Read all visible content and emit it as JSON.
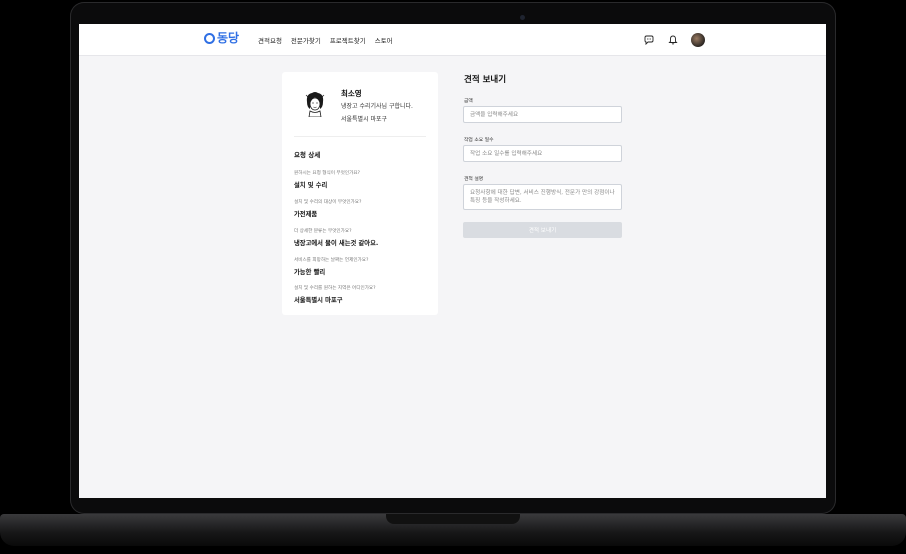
{
  "header": {
    "logo_text": "동당",
    "nav": [
      "견적요청",
      "전문가찾기",
      "프로젝트찾기",
      "스토어"
    ],
    "icons": [
      "chat-icon",
      "bell-icon",
      "avatar"
    ]
  },
  "profile": {
    "name": "최소영",
    "intro": "냉장고 수리기사님 구합니다.",
    "region": "서울특별시 마포구"
  },
  "request_detail": {
    "title": "요청 상세",
    "items": [
      {
        "q": "원하시는 요청 형식이 무엇인가요?",
        "a": "설치 및 수리"
      },
      {
        "q": "설치 및 수리의 대상이 무엇인가요?",
        "a": "가전제품"
      },
      {
        "q": "더 상세한 분류는 무엇인가요?",
        "a": "냉장고에서 물이 새는것 같아요."
      },
      {
        "q": "서비스를 희망하는 날짜는 언제인가요?",
        "a": "가능한 빨리"
      },
      {
        "q": "설치 및 수리를 원하는 지역은 어디인가요?",
        "a": "서울특별시 마포구"
      }
    ]
  },
  "quote_form": {
    "title": "견적 보내기",
    "amount_label": "금액",
    "amount_placeholder": "금액을 입력해주세요",
    "days_label": "작업 소요 일수",
    "days_placeholder": "작업 소요 일수를 입력해주세요",
    "desc_label": "견적 설명",
    "desc_placeholder": "요청사항에 대한 답변, 서비스 진행방식, 전문가 만의 강점이나 특징 등을 작성하세요.",
    "submit_label": "견적 보내기"
  }
}
